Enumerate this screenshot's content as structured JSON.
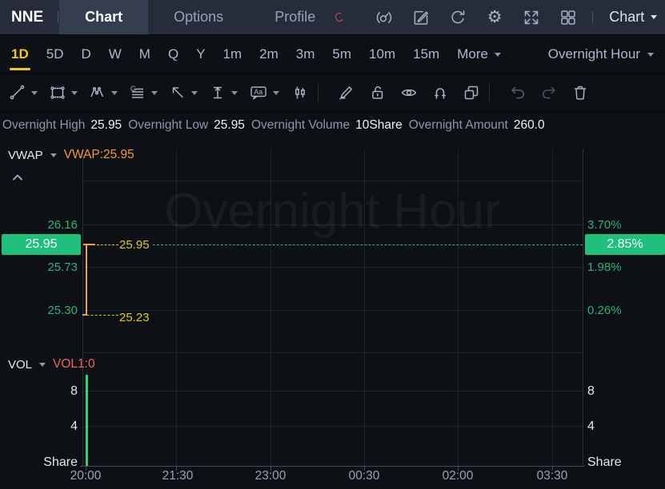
{
  "header": {
    "symbol": "NNE",
    "tabs": [
      {
        "label": "Chart"
      },
      {
        "label": "Options"
      },
      {
        "label": "Profile"
      }
    ],
    "view_dropdown_label": "Chart",
    "icons": [
      "gauge-icon",
      "annotate-icon",
      "refresh-icon",
      "settings-gear-icon",
      "fullscreen-icon",
      "layout-grid-icon"
    ]
  },
  "timeframe_bar": {
    "items": [
      "1D",
      "5D",
      "D",
      "W",
      "M",
      "Q",
      "Y",
      "1m",
      "2m",
      "3m",
      "5m",
      "10m",
      "15m"
    ],
    "active_item": "1D",
    "more_label": "More",
    "session_label": "Overnight Hour"
  },
  "drawing_toolbar": {
    "tool_icons": [
      "trend-line-icon",
      "rectangle-icon",
      "wave-pattern-icon",
      "gann-lines-icon",
      "arrow-icon",
      "price-range-icon",
      "text-note-icon",
      "candlestick-pattern-icon",
      "brush-icon",
      "unlock-icon",
      "visibility-eye-icon",
      "magnet-icon",
      "clone-icon",
      "undo-icon",
      "redo-icon",
      "trash-icon"
    ]
  },
  "status_bar": {
    "items": [
      {
        "label": "Overnight High",
        "value": "25.95"
      },
      {
        "label": "Overnight Low",
        "value": "25.95"
      },
      {
        "label": "Overnight Volume",
        "value": "10Share"
      },
      {
        "label": "Overnight Amount",
        "value": "260.0"
      }
    ]
  },
  "price_panel": {
    "indicator_name": "VWAP",
    "indicator_reading": "VWAP:25.95",
    "watermark": "Overnight Hour",
    "axis_left": [
      "26.16",
      "25.73",
      "25.30"
    ],
    "axis_right": [
      "3.70%",
      "1.98%",
      "0.26%"
    ],
    "last_price": "25.95",
    "last_change_pct": "2.85%",
    "line_high_label": "25.95",
    "line_low_label": "25.23"
  },
  "volume_panel": {
    "indicator_name": "VOL",
    "indicator_reading": "VOL1:0",
    "axis_ticks": [
      "8",
      "4"
    ],
    "unit_label": "Share"
  },
  "time_axis": {
    "ticks": [
      "20:00",
      "21:30",
      "23:00",
      "00:30",
      "02:00",
      "03:30"
    ]
  },
  "colors": {
    "topbar_bg": "#262c39",
    "page_bg": "#0d1014",
    "accent_yellow": "#f3c620",
    "axis_green": "#2eb277",
    "highlight_green": "#1fc07c",
    "vwap_orange": "#f09a38",
    "price_line_orange": "#f0a532",
    "volume_red": "#f2635f",
    "volume_bar_green": "#2bd374"
  },
  "chart_data": {
    "type": "line",
    "symbol": "NNE",
    "session": "Overnight Hour",
    "interval": "1D",
    "x_ticks": [
      "20:00",
      "21:30",
      "23:00",
      "00:30",
      "02:00",
      "03:30"
    ],
    "price_axis_left": [
      26.16,
      25.95,
      25.73,
      25.3
    ],
    "pct_axis_right": [
      3.7,
      2.85,
      1.98,
      0.26
    ],
    "price_series": [
      {
        "x": "20:00",
        "low": 25.23,
        "high": 25.95
      }
    ],
    "vwap": 25.95,
    "last_price": 25.95,
    "last_change_pct": 2.85,
    "volume_axis_ticks": [
      8,
      4
    ],
    "volume_unit": "Share",
    "volume_series": [
      {
        "x": "20:00",
        "value": 10
      }
    ],
    "overnight_high": 25.95,
    "overnight_low": 25.95,
    "overnight_volume": "10Share",
    "overnight_amount": "260.0"
  }
}
